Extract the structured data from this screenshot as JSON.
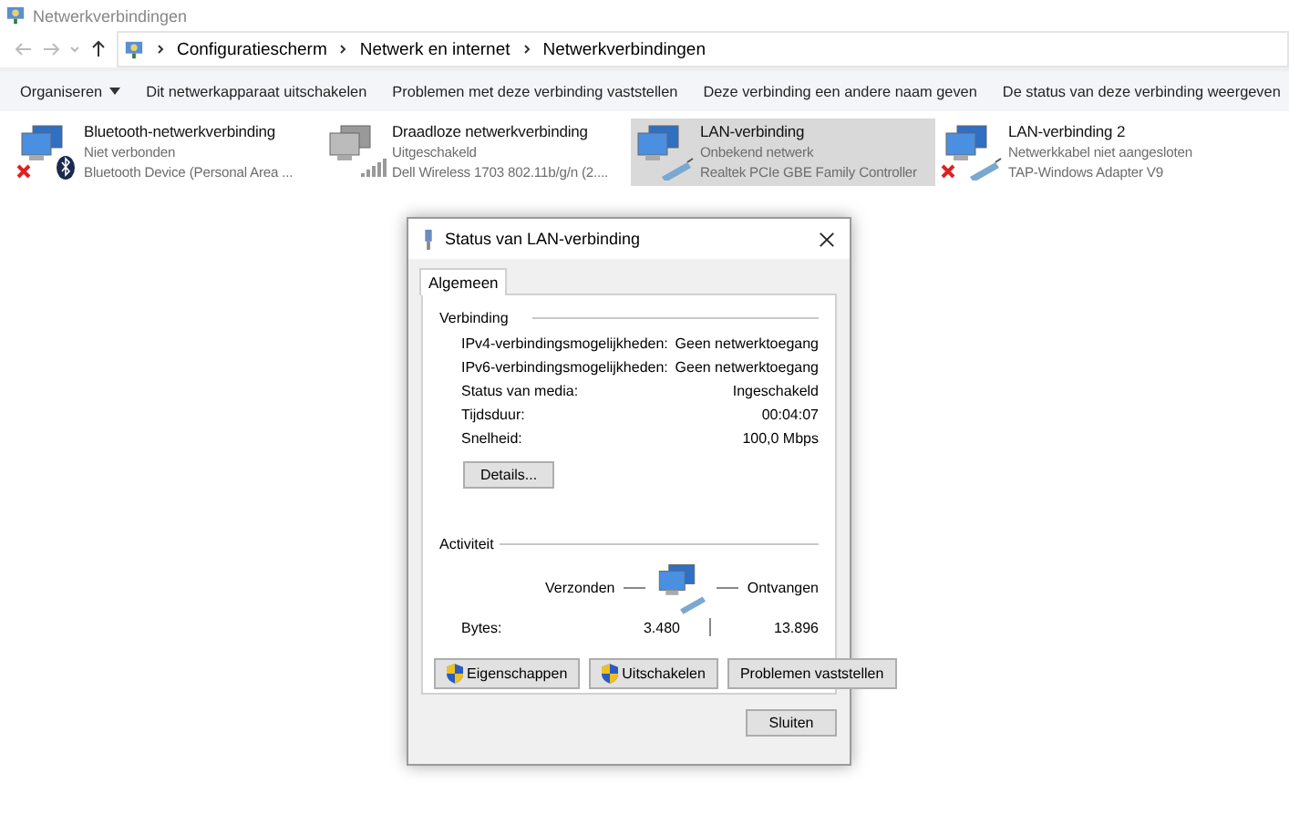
{
  "window": {
    "title": "Netwerkverbindingen"
  },
  "address": {
    "path": [
      "Configuratiescherm",
      "Netwerk en internet",
      "Netwerkverbindingen"
    ]
  },
  "toolbar": [
    {
      "label": "Organiseren",
      "dropdown": true
    },
    {
      "label": "Dit netwerkapparaat uitschakelen",
      "dropdown": false
    },
    {
      "label": "Problemen met deze verbinding vaststellen",
      "dropdown": false
    },
    {
      "label": "Deze verbinding een andere naam geven",
      "dropdown": false
    },
    {
      "label": "De status van deze verbinding weergeven",
      "dropdown": false
    }
  ],
  "connections": [
    {
      "name": "Bluetooth-netwerkverbinding",
      "status": "Niet verbonden",
      "device": "Bluetooth Device (Personal Area ...",
      "kind": "bluetooth",
      "disconnected": true,
      "disabled": false,
      "selected": false
    },
    {
      "name": "Draadloze netwerkverbinding",
      "status": "Uitgeschakeld",
      "device": "Dell Wireless 1703 802.11b/g/n (2....",
      "kind": "wireless",
      "disconnected": false,
      "disabled": true,
      "selected": false
    },
    {
      "name": "LAN-verbinding",
      "status": "Onbekend netwerk",
      "device": "Realtek PCIe GBE Family Controller",
      "kind": "cable",
      "disconnected": false,
      "disabled": false,
      "selected": true
    },
    {
      "name": "LAN-verbinding 2",
      "status": "Netwerkkabel niet aangesloten",
      "device": "TAP-Windows Adapter V9",
      "kind": "cable",
      "disconnected": true,
      "disabled": false,
      "selected": false
    }
  ],
  "dialog": {
    "title": "Status van LAN-verbinding",
    "tabs": [
      {
        "label": "Algemeen",
        "selected": true
      }
    ],
    "connection_heading": "Verbinding",
    "rows": [
      {
        "label": "IPv4-verbindingsmogelijkheden:",
        "value": "Geen netwerktoegang"
      },
      {
        "label": "IPv6-verbindingsmogelijkheden:",
        "value": "Geen netwerktoegang"
      },
      {
        "label": "Status van media:",
        "value": "Ingeschakeld"
      },
      {
        "label": "Tijdsduur:",
        "value": "00:04:07"
      },
      {
        "label": "Snelheid:",
        "value": "100,0 Mbps"
      }
    ],
    "details_button": "Details...",
    "activity_heading": "Activiteit",
    "sent_label": "Verzonden",
    "received_label": "Ontvangen",
    "bytes_label": "Bytes:",
    "bytes_sent": "3.480",
    "bytes_received": "13.896",
    "buttons": [
      {
        "label": "Eigenschappen",
        "kind": "shield"
      },
      {
        "label": "Uitschakelen",
        "kind": "shield"
      },
      {
        "label": "Problemen vaststellen",
        "kind": "plain"
      }
    ],
    "close_button": "Sluiten"
  }
}
